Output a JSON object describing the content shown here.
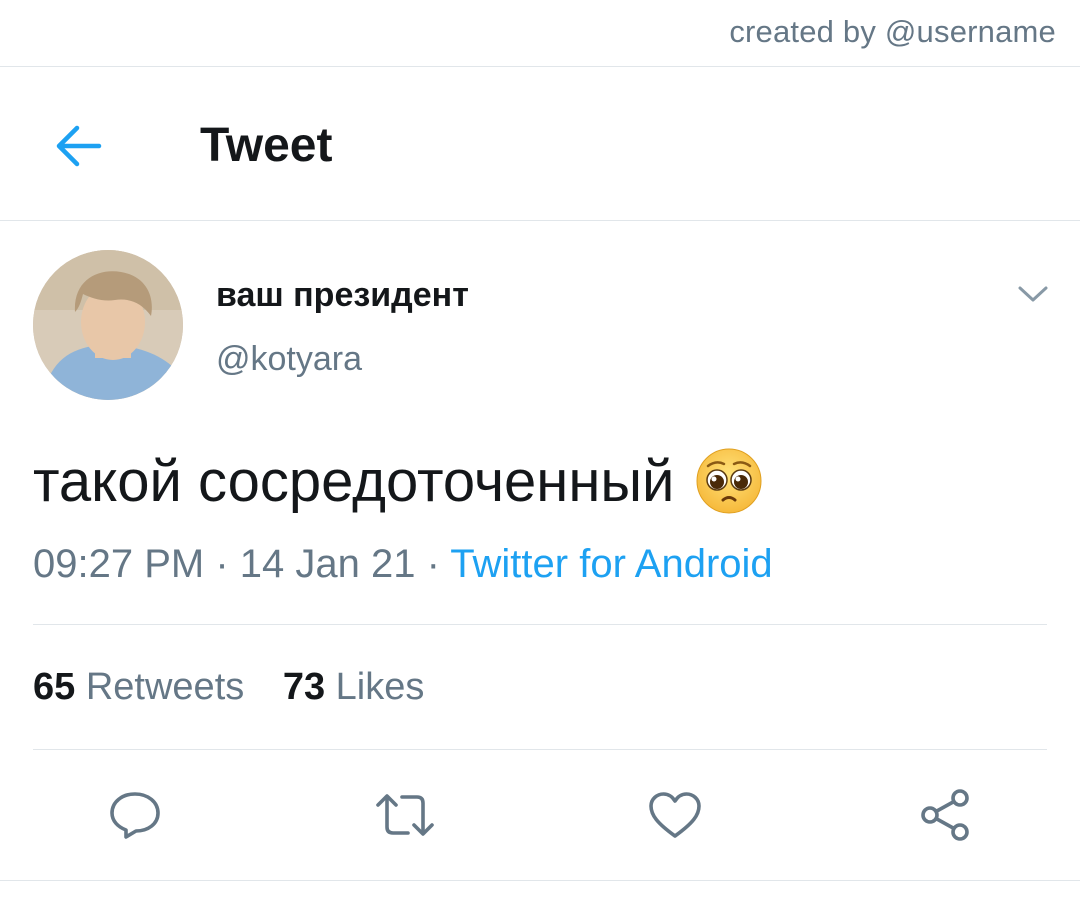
{
  "credit": "created by @username",
  "header": {
    "title": "Tweet",
    "back_icon": "arrow-left-icon",
    "accent": "#1da1f2"
  },
  "author": {
    "display_name": "ваш президент",
    "handle": "@kotyara"
  },
  "tweet": {
    "text": "такой сосредоточенный",
    "emoji": "pleading-face-icon",
    "time": "09:27 PM",
    "sep1": " · ",
    "date": "14 Jan 21",
    "sep2": " · ",
    "source": "Twitter for Android"
  },
  "stats": {
    "retweets_count": "65",
    "retweets_label": "Retweets",
    "likes_count": "73",
    "likes_label": "Likes"
  },
  "actions": [
    "reply-icon",
    "retweet-icon",
    "like-icon",
    "share-icon"
  ],
  "colors": {
    "text_primary": "#14171a",
    "text_secondary": "#657786",
    "link": "#1da1f2",
    "divider": "#e1e6ea"
  }
}
